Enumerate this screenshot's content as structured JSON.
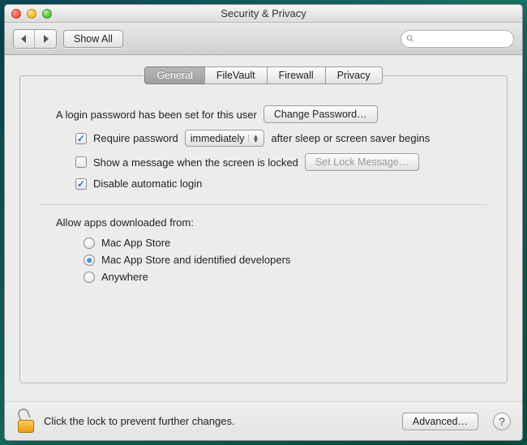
{
  "window": {
    "title": "Security & Privacy"
  },
  "toolbar": {
    "show_all_label": "Show All",
    "search_placeholder": ""
  },
  "tabs": [
    {
      "label": "General",
      "active": true
    },
    {
      "label": "FileVault",
      "active": false
    },
    {
      "label": "Firewall",
      "active": false
    },
    {
      "label": "Privacy",
      "active": false
    }
  ],
  "general": {
    "login_password_set_label": "A login password has been set for this user",
    "change_password_button": "Change Password…",
    "require_password": {
      "checked": true,
      "label": "Require password",
      "delay_selected": "immediately",
      "suffix_label": "after sleep or screen saver begins"
    },
    "show_message": {
      "checked": false,
      "label": "Show a message when the screen is locked",
      "set_lock_button": "Set Lock Message…",
      "button_enabled": false
    },
    "disable_auto_login": {
      "checked": true,
      "label": "Disable automatic login"
    },
    "gatekeeper": {
      "heading": "Allow apps downloaded from:",
      "options": [
        {
          "label": "Mac App Store",
          "selected": false
        },
        {
          "label": "Mac App Store and identified developers",
          "selected": true
        },
        {
          "label": "Anywhere",
          "selected": false
        }
      ]
    }
  },
  "footer": {
    "lock_label": "Click the lock to prevent further changes.",
    "advanced_button": "Advanced…",
    "help_label": "?"
  }
}
